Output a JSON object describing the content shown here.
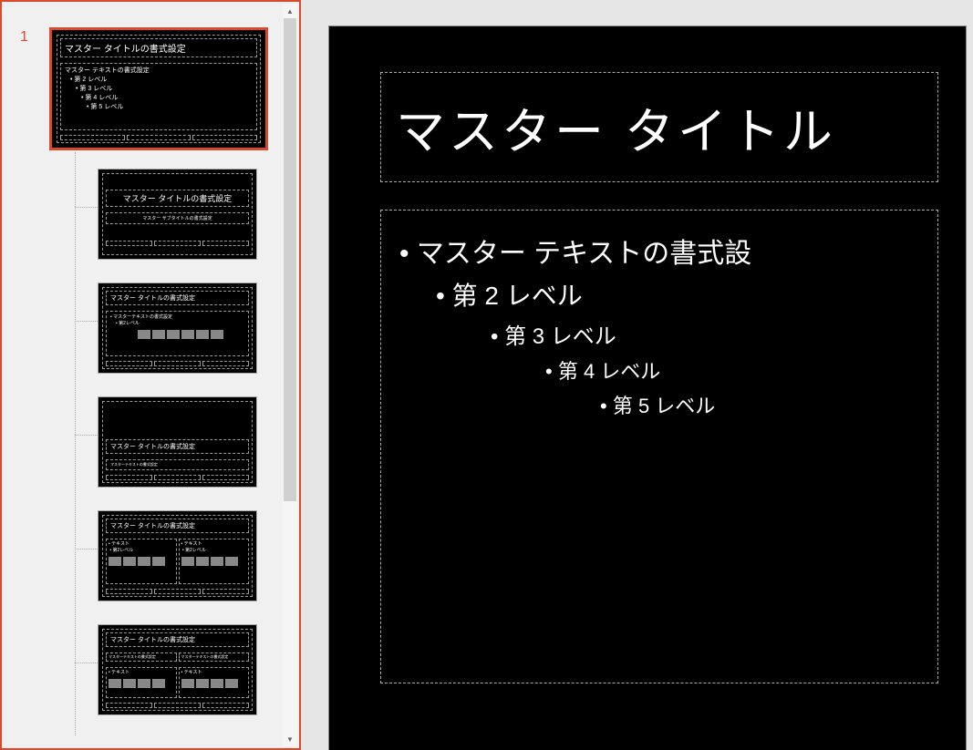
{
  "slideNumber": "1",
  "master": {
    "title": "マスター タイトルの書式設定",
    "body": {
      "lvl1": "マスター テキストの書式設定",
      "lvl2": "第 2 レベル",
      "lvl3": "第 3 レベル",
      "lvl4": "第 4 レベル",
      "lvl5": "第 5 レベル"
    }
  },
  "layouts": [
    {
      "title": "マスター タイトルの書式設定",
      "subtitle": "マスター サブタイトルの書式設定",
      "type": "title"
    },
    {
      "title": "マスター タイトルの書式設定",
      "type": "content"
    },
    {
      "title": "マスター タイトルの書式設定",
      "type": "section"
    },
    {
      "title": "マスター タイトルの書式設定",
      "type": "two-content"
    },
    {
      "title": "マスター タイトルの書式設定",
      "type": "comparison"
    }
  ],
  "editor": {
    "title": "マスター タイトル",
    "lvl1": "マスター テキストの書式設",
    "lvl2": "第 2 レベル",
    "lvl3": "第 3 レベル",
    "lvl4": "第 4 レベル",
    "lvl5": "第 5 レベル"
  }
}
